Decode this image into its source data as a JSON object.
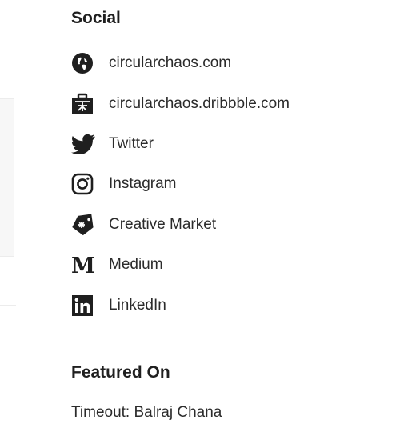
{
  "social": {
    "title": "Social",
    "items": [
      {
        "icon": "globe-icon",
        "label": "circularchaos.com"
      },
      {
        "icon": "dribbble-briefcase-icon",
        "label": "circularchaos.dribbble.com"
      },
      {
        "icon": "twitter-icon",
        "label": "Twitter"
      },
      {
        "icon": "instagram-icon",
        "label": "Instagram"
      },
      {
        "icon": "price-tag-icon",
        "label": "Creative Market"
      },
      {
        "icon": "medium-icon",
        "label": "Medium"
      },
      {
        "icon": "linkedin-icon",
        "label": "LinkedIn"
      }
    ]
  },
  "featured": {
    "title": "Featured On",
    "items": [
      {
        "label": "Timeout: Balraj Chana"
      }
    ]
  },
  "colors": {
    "text": "#1f1f1f",
    "icon": "#1f1f1f",
    "background": "#ffffff"
  }
}
